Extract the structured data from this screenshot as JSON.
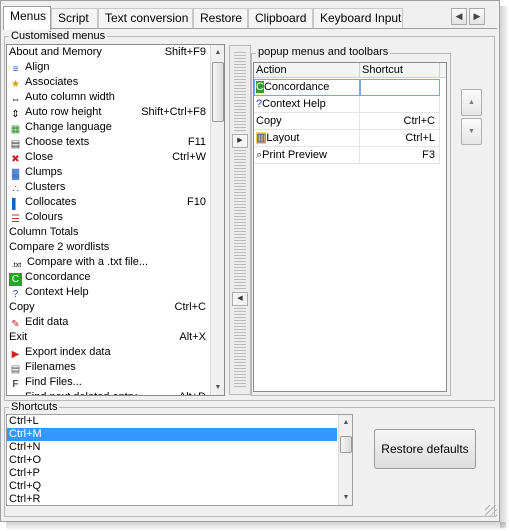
{
  "tabs": [
    "Menus",
    "Script",
    "Text conversion",
    "Restore",
    "Clipboard",
    "Keyboard Input"
  ],
  "customised_menus": {
    "title": "Customised menus",
    "items": [
      {
        "label": "About and Memory",
        "shortcut": "Shift+F9",
        "icon": "none"
      },
      {
        "label": "Align",
        "shortcut": "",
        "icon": "align-icon"
      },
      {
        "label": "Associates",
        "shortcut": "",
        "icon": "associates-icon"
      },
      {
        "label": "Auto column width",
        "shortcut": "",
        "icon": "column-width-icon"
      },
      {
        "label": "Auto row height",
        "shortcut": "Shift+Ctrl+F8",
        "icon": "row-height-icon"
      },
      {
        "label": "Change language",
        "shortcut": "",
        "icon": "language-icon"
      },
      {
        "label": "Choose texts",
        "shortcut": "F11",
        "icon": "texts-icon"
      },
      {
        "label": "Close",
        "shortcut": "Ctrl+W",
        "icon": "close-icon"
      },
      {
        "label": "Clumps",
        "shortcut": "",
        "icon": "clumps-icon"
      },
      {
        "label": "Clusters",
        "shortcut": "",
        "icon": "clusters-icon"
      },
      {
        "label": "Collocates",
        "shortcut": "F10",
        "icon": "collocates-icon"
      },
      {
        "label": "Colours",
        "shortcut": "",
        "icon": "colours-icon"
      },
      {
        "label": "Column Totals",
        "shortcut": "",
        "icon": "none"
      },
      {
        "label": "Compare 2 wordlists",
        "shortcut": "",
        "icon": "none"
      },
      {
        "label": "Compare with a .txt file...",
        "shortcut": "",
        "icon": "txt-icon"
      },
      {
        "label": "Concordance",
        "shortcut": "",
        "icon": "concordance-icon"
      },
      {
        "label": "Context Help",
        "shortcut": "",
        "icon": "help-icon"
      },
      {
        "label": "Copy",
        "shortcut": "Ctrl+C",
        "icon": "none"
      },
      {
        "label": "Edit data",
        "shortcut": "",
        "icon": "edit-icon"
      },
      {
        "label": "Exit",
        "shortcut": "Alt+X",
        "icon": "none"
      },
      {
        "label": "Export index data",
        "shortcut": "",
        "icon": "export-icon"
      },
      {
        "label": "Filenames",
        "shortcut": "",
        "icon": "filenames-icon"
      },
      {
        "label": "Find Files...",
        "shortcut": "",
        "icon": "find-files-icon"
      },
      {
        "label": "Find next deleted entry",
        "shortcut": "Alt+D",
        "icon": "find-next-icon"
      }
    ]
  },
  "popup_menus": {
    "title": "popup menus and toolbars",
    "columns": [
      "Action",
      "Shortcut"
    ],
    "rows": [
      {
        "action": "Concordance",
        "shortcut": "",
        "icon": "concordance-icon"
      },
      {
        "action": "Context Help",
        "shortcut": "",
        "icon": "help-icon"
      },
      {
        "action": "Copy",
        "shortcut": "Ctrl+C",
        "icon": "none"
      },
      {
        "action": "Layout",
        "shortcut": "Ctrl+L",
        "icon": "layout-icon"
      },
      {
        "action": "Print Preview",
        "shortcut": "F3",
        "icon": "print-preview-icon"
      }
    ]
  },
  "shortcuts": {
    "title": "Shortcuts",
    "items": [
      "Ctrl+L",
      "Ctrl+M",
      "Ctrl+N",
      "Ctrl+O",
      "Ctrl+P",
      "Ctrl+Q",
      "Ctrl+R"
    ],
    "selected": "Ctrl+M"
  },
  "restore_defaults_label": "Restore defaults",
  "colors": {
    "selection": "#3399ff",
    "window_bg": "#f0f0f0"
  }
}
